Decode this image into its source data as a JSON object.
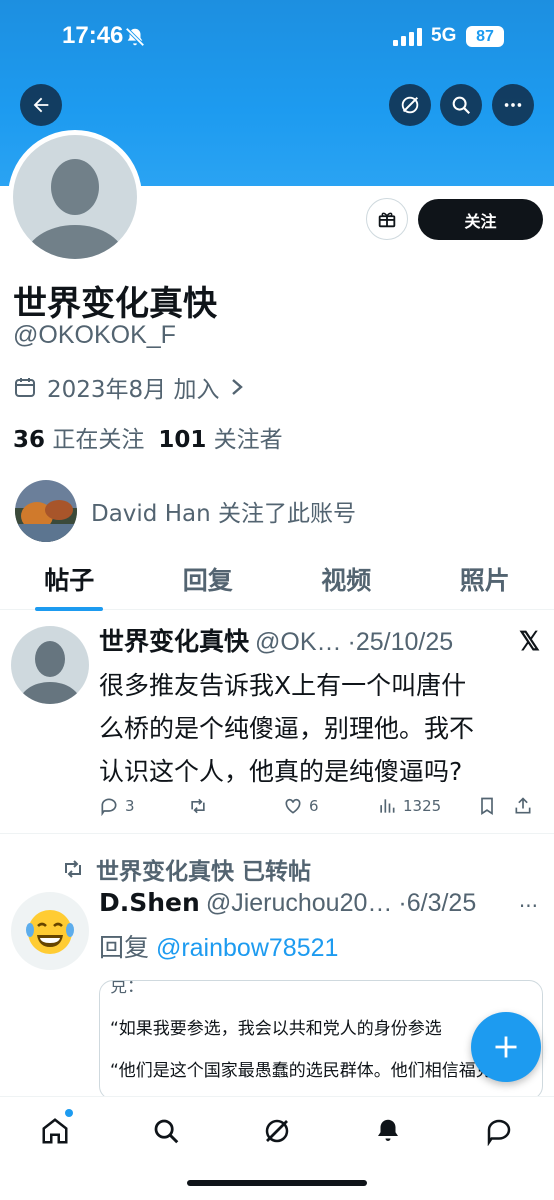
{
  "status_bar": {
    "time": "17:46",
    "network": "5G",
    "battery": "87"
  },
  "profile": {
    "display_name": "世界变化真快",
    "handle": "@OKOKOK_F",
    "joined": "2023年8月 加入",
    "following_count": "36",
    "following_label": "正在关注",
    "followers_count": "101",
    "followers_label": "关注者",
    "followed_by": "David Han 关注了此账号",
    "follow_button": "关注"
  },
  "tabs": [
    {
      "label": "帖子",
      "active": true
    },
    {
      "label": "回复",
      "active": false
    },
    {
      "label": "视频",
      "active": false
    },
    {
      "label": "照片",
      "active": false
    }
  ],
  "posts": [
    {
      "author": "世界变化真快",
      "handle": "@OK…",
      "date": "·25/10/25",
      "text_lines": [
        "很多推友告诉我X上有一个叫唐什",
        "么桥的是个纯傻逼，别理他。我不",
        "认识这个人，他真的是纯傻逼吗?"
      ],
      "replies": "3",
      "retweets": "",
      "likes": "6",
      "views": "1325"
    },
    {
      "retweet_label": "世界变化真快 已转帖",
      "author": "D.Shen",
      "handle": "@Jieruchou20…",
      "date": "·6/3/25",
      "reply_prefix": "回复 ",
      "reply_to": "@rainbow78521",
      "quote_top": "兑：",
      "quote_line1": "“如果我要参选，我会以共和党人的身份参选",
      "quote_line2": "“他们是这个国家最愚蠢的选民群体。他们相信福克"
    }
  ],
  "icons": {
    "back": "back-arrow-icon",
    "grok": "grok-icon",
    "search": "search-icon",
    "more": "more-icon"
  },
  "colors": {
    "accent": "#1d9bf0",
    "text": "#0f1419",
    "muted": "#536471"
  }
}
